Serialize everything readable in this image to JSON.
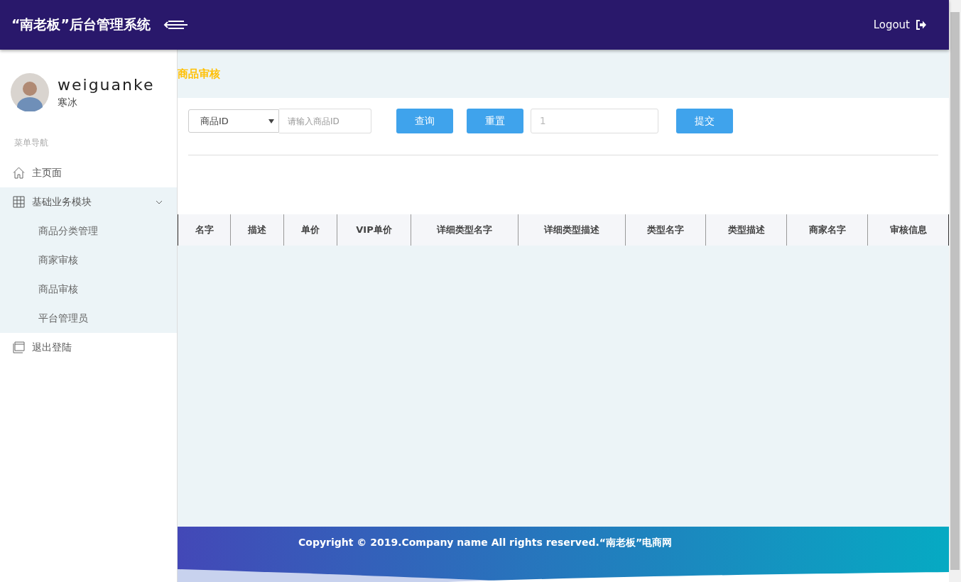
{
  "header": {
    "title": "“南老板”后台管理系统",
    "logout": "Logout"
  },
  "user": {
    "name": "weiguanke",
    "role": "寒冰"
  },
  "sidebar": {
    "heading": "菜单导航",
    "items": [
      {
        "kind": "home",
        "label": "主页面"
      },
      {
        "kind": "grid",
        "label": "基础业务模块",
        "expanded": true,
        "children": [
          {
            "label": "商品分类管理"
          },
          {
            "label": "商家审核"
          },
          {
            "label": "商品审核"
          },
          {
            "label": "平台管理员"
          }
        ]
      },
      {
        "kind": "window",
        "label": "退出登陆"
      }
    ]
  },
  "page_title": "商品审核",
  "toolbar": {
    "select_value": "商品ID",
    "search_placeholder": "请输入商品ID",
    "query_button": "查询",
    "reset_button": "重置",
    "value_placeholder": "1",
    "submit_button": "提交"
  },
  "table": {
    "columns": [
      "名字",
      "描述",
      "单价",
      "VIP单价",
      "详细类型名字",
      "详细类型描述",
      "类型名字",
      "类型描述",
      "商家名字",
      "审核信息"
    ]
  },
  "footer": {
    "copyright": "Copyright © 2019.Company name All rights reserved.“南老板”电商网"
  }
}
